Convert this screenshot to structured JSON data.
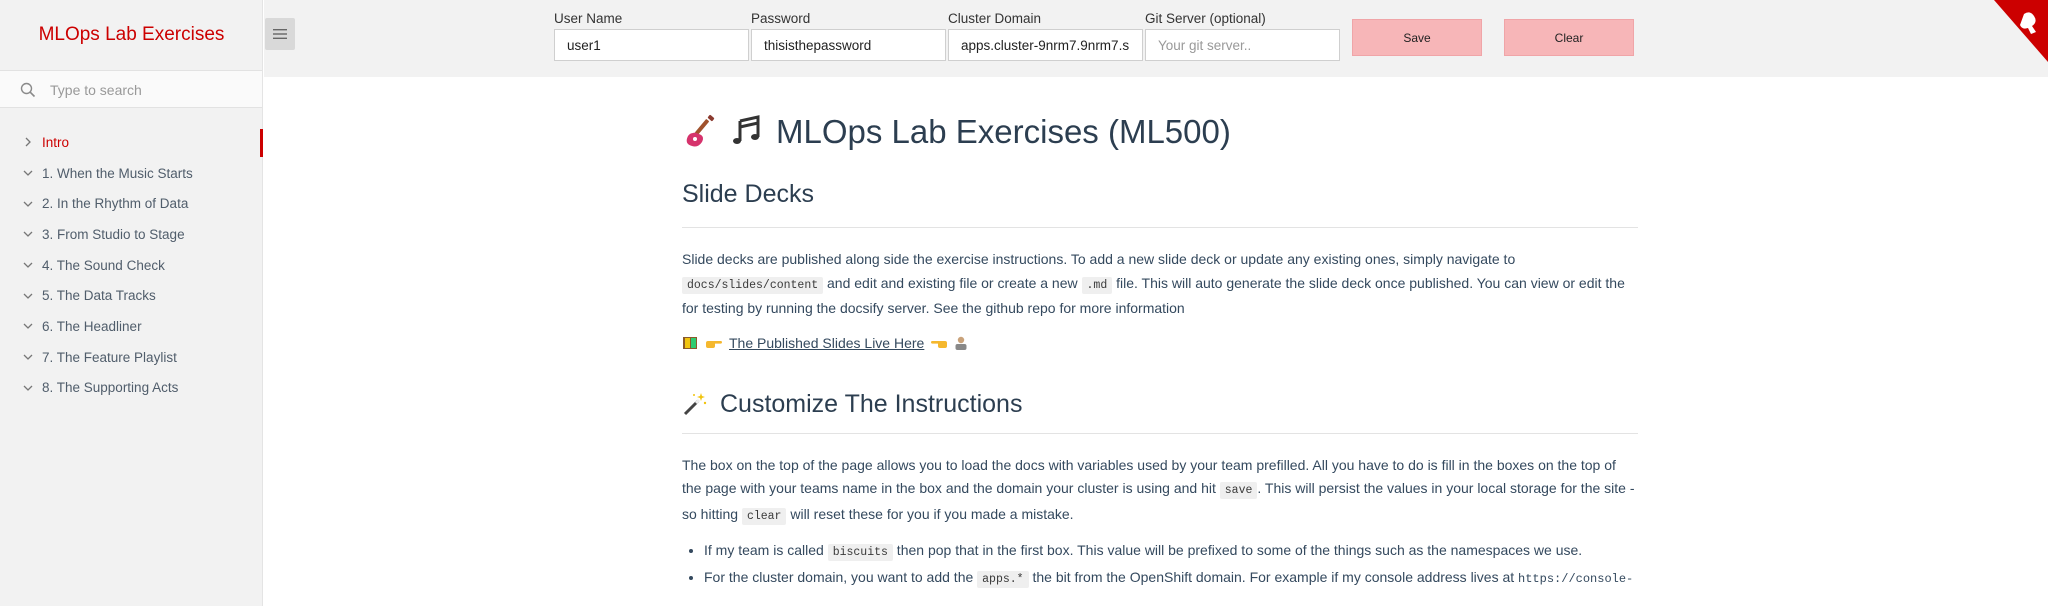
{
  "sidebar": {
    "app_title": "MLOps Lab Exercises",
    "search_placeholder": "Type to search",
    "items": [
      {
        "label": "Intro"
      },
      {
        "label": "1. When the Music Starts"
      },
      {
        "label": "2. In the Rhythm of Data"
      },
      {
        "label": "3. From Studio to Stage"
      },
      {
        "label": "4. The Sound Check"
      },
      {
        "label": "5. The Data Tracks"
      },
      {
        "label": "6. The Headliner"
      },
      {
        "label": "7. The Feature Playlist"
      },
      {
        "label": "8. The Supporting Acts"
      }
    ]
  },
  "topbar": {
    "username": {
      "label": "User Name",
      "value": "user1"
    },
    "password": {
      "label": "Password",
      "value": "thisisthepassword"
    },
    "cluster": {
      "label": "Cluster Domain",
      "value": "apps.cluster-9nrm7.9nrm7.s"
    },
    "git": {
      "label": "Git Server (optional)",
      "placeholder": "Your git server.."
    },
    "save_label": "Save",
    "clear_label": "Clear"
  },
  "content": {
    "title": "MLOps Lab Exercises (ML500)",
    "slide_decks": {
      "heading": "Slide Decks",
      "p1_a": "Slide decks are published along side the exercise instructions. To add a new slide deck or update any existing ones, simply navigate to",
      "code_path": "docs/slides/content",
      "p1_b": " and edit and existing file or create a new ",
      "code_md": ".md",
      "p1_c": " file. This will auto generate the slide deck once published. You can view or edit the for testing by running the docsify server. See the github repo for more information",
      "link_text": "The Published Slides Live Here"
    },
    "customize": {
      "heading": "Customize The Instructions",
      "p_a": "The box on the top of the page allows you to load the docs with variables used by your team prefilled. All you have to do is fill in the boxes on the top of the page with your teams name in the box and the domain your cluster is using and hit ",
      "code_save": "save",
      "p_b": ". This will persist the values in your local storage for the site - so hitting ",
      "code_clear": "clear",
      "p_c": " will reset these for you if you made a mistake.",
      "li1_a": "If my team is called ",
      "li1_code": "biscuits",
      "li1_b": " then pop that in the first box. This value will be prefixed to some of the things such as the namespaces we use.",
      "li2_a": "For the cluster domain, you want to add the ",
      "li2_code": "apps.*",
      "li2_b": " the bit from the OpenShift domain. For example if my console address lives at ",
      "li2_url": "https://console-"
    }
  },
  "colors": {
    "accent": "#cc0000",
    "button_bg": "#f7b6b8",
    "sidebar_bg": "#f2f2f2"
  },
  "icons": [
    "search-icon",
    "chevron-right-icon",
    "chevron-down-icon",
    "hamburger-icon",
    "guitar-icon",
    "music-notes-icon",
    "book-icon",
    "pointing-right-icon",
    "pointing-left-icon",
    "person-icon",
    "magic-wand-icon",
    "redhat-corner-icon"
  ]
}
